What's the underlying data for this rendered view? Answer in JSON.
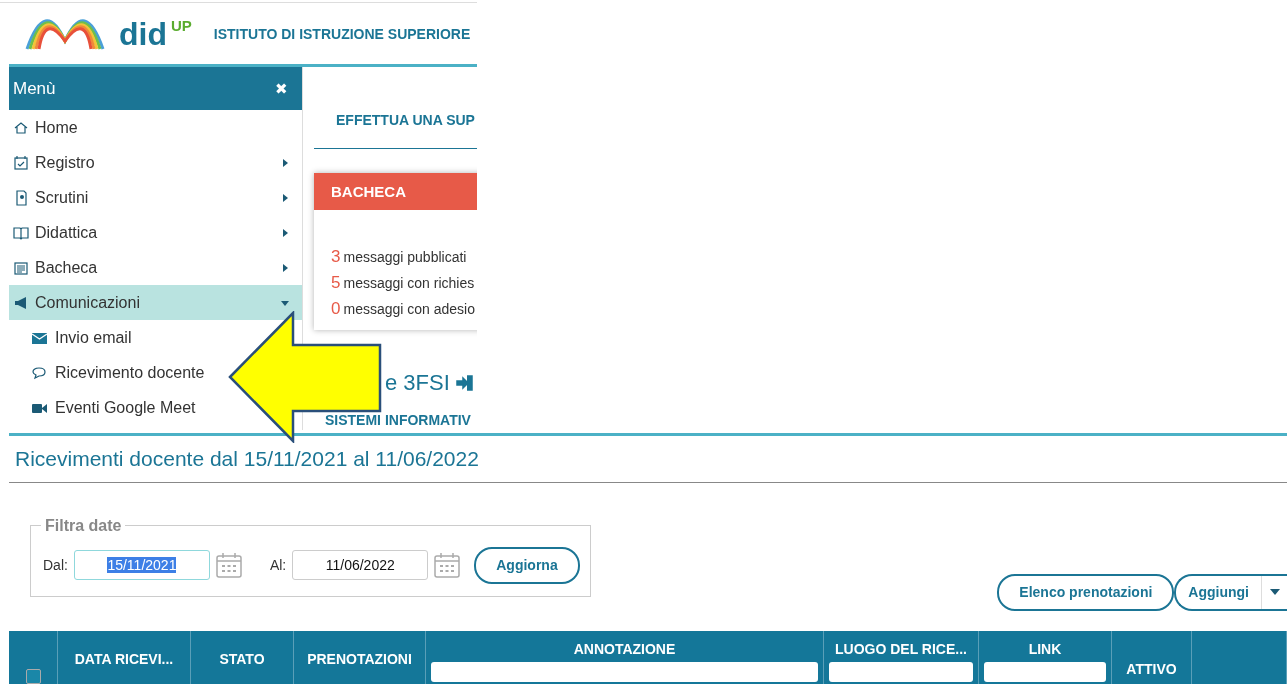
{
  "header": {
    "logo": {
      "name": "did",
      "sup": "UP"
    },
    "school": "ISTITUTO DI ISTRUZIONE SUPERIORE"
  },
  "menu": {
    "title": "Menù",
    "close": "✖",
    "items": [
      {
        "label": "Home",
        "kind": "link",
        "selected": false
      },
      {
        "label": "Registro",
        "kind": "submenu",
        "selected": false,
        "expanded": false
      },
      {
        "label": "Scrutini",
        "kind": "submenu",
        "selected": false,
        "expanded": false
      },
      {
        "label": "Didattica",
        "kind": "submenu",
        "selected": false,
        "expanded": false
      },
      {
        "label": "Bacheca",
        "kind": "submenu",
        "selected": false,
        "expanded": false
      },
      {
        "label": "Comunicazioni",
        "kind": "submenu",
        "selected": true,
        "expanded": true,
        "children": [
          {
            "label": "Invio email"
          },
          {
            "label": "Ricevimento docente"
          },
          {
            "label": "Eventi Google Meet"
          }
        ]
      }
    ]
  },
  "dashboard": {
    "action": "EFFETTUA UNA SUP",
    "bacheca": {
      "title": "BACHECA",
      "stats": [
        {
          "count": "3",
          "text": "messaggi pubblicati"
        },
        {
          "count": "5",
          "text": "messaggi con richies"
        },
        {
          "count": "0",
          "text": "messaggi con adesio"
        }
      ]
    },
    "class_name": "e 3FSI",
    "class_subtitle": "SISTEMI INFORMATIV"
  },
  "page_title": "Ricevimenti docente dal 15/11/2021 al 11/06/2022",
  "filter": {
    "legend": "Filtra date",
    "from_label": "Dal:",
    "from_value": "15/11/2021",
    "from_text_selected": true,
    "to_label": "Al:",
    "to_value": "11/06/2022",
    "button": "Aggiorna"
  },
  "actions": [
    {
      "label": "Elenco prenotazioni",
      "kind": "button"
    },
    {
      "label": "Aggiungi",
      "kind": "split"
    }
  ],
  "table": {
    "columns": [
      {
        "kind": "checkbox",
        "checked": false
      },
      {
        "kind": "text",
        "label": "DATA RICEVI..."
      },
      {
        "kind": "text",
        "label": "STATO"
      },
      {
        "kind": "text",
        "label": "PRENOTAZIONI"
      },
      {
        "kind": "filter",
        "label": "ANNOTAZIONE"
      },
      {
        "kind": "filter",
        "label": "LUOGO DEL RICE..."
      },
      {
        "kind": "filter",
        "label": "LINK"
      },
      {
        "kind": "low",
        "label": "ATTIVO"
      },
      {
        "kind": "empty"
      }
    ]
  }
}
